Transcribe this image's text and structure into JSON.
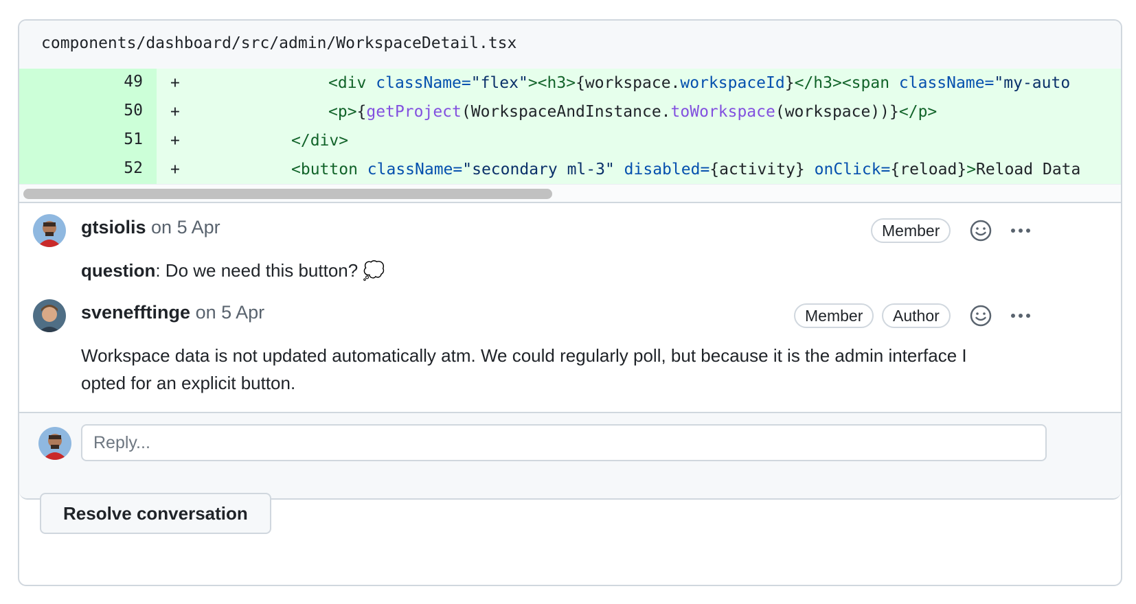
{
  "file": {
    "path": "components/dashboard/src/admin/WorkspaceDetail.tsx"
  },
  "diff": {
    "plus_sign": "+",
    "lines": [
      {
        "number": "49",
        "tokens": [
          {
            "t": "<div ",
            "c": "tag"
          },
          {
            "t": "className=",
            "c": "attr"
          },
          {
            "t": "\"flex\"",
            "c": "str"
          },
          {
            "t": "><h3>",
            "c": "tag"
          },
          {
            "t": "{workspace.",
            "c": "plain"
          },
          {
            "t": "workspaceId",
            "c": "attr"
          },
          {
            "t": "}",
            "c": "plain"
          },
          {
            "t": "</h3><span ",
            "c": "tag"
          },
          {
            "t": "className=",
            "c": "attr"
          },
          {
            "t": "\"my-auto",
            "c": "str"
          }
        ]
      },
      {
        "number": "50",
        "tokens": [
          {
            "t": "<p>",
            "c": "tag"
          },
          {
            "t": "{",
            "c": "plain"
          },
          {
            "t": "getProject",
            "c": "fn"
          },
          {
            "t": "(WorkspaceAndInstance.",
            "c": "plain"
          },
          {
            "t": "toWorkspace",
            "c": "fn"
          },
          {
            "t": "(workspace))}",
            "c": "plain"
          },
          {
            "t": "</p>",
            "c": "tag"
          }
        ]
      },
      {
        "number": "51",
        "tokens": [
          {
            "t": "</div>",
            "c": "tag"
          }
        ]
      },
      {
        "number": "52",
        "tokens": [
          {
            "t": "<button ",
            "c": "tag"
          },
          {
            "t": "className=",
            "c": "attr"
          },
          {
            "t": "\"secondary ml-3\" ",
            "c": "str"
          },
          {
            "t": "disabled=",
            "c": "attr"
          },
          {
            "t": "{activity} ",
            "c": "plain"
          },
          {
            "t": "onClick=",
            "c": "attr"
          },
          {
            "t": "{reload}",
            "c": "plain"
          },
          {
            "t": ">",
            "c": "tag"
          },
          {
            "t": "Reload Data",
            "c": "plain"
          }
        ]
      }
    ]
  },
  "comments": [
    {
      "author": "gtsiolis",
      "date": "on 5 Apr",
      "badges": [
        "Member"
      ],
      "body_bold": "question",
      "body": ": Do we need this button? 💭",
      "avatar": "avatar-gtsiolis"
    },
    {
      "author": "svenefftinge",
      "date": "on 5 Apr",
      "badges": [
        "Member",
        "Author"
      ],
      "body_line1": "Workspace data is not updated automatically atm. We could regularly poll, but because it is the admin interface I",
      "body_line2": "opted for an explicit button.",
      "avatar": "avatar-svenefftinge"
    }
  ],
  "reply": {
    "placeholder": "Reply..."
  },
  "actions": {
    "resolve_label": "Resolve conversation"
  },
  "icons": {
    "emoji": "smiley-icon",
    "more": "kebab-horizontal-icon"
  },
  "colors": {
    "addition_bg": "#e6ffec",
    "addition_gutter": "#ccffd8",
    "border": "#d0d7de"
  }
}
